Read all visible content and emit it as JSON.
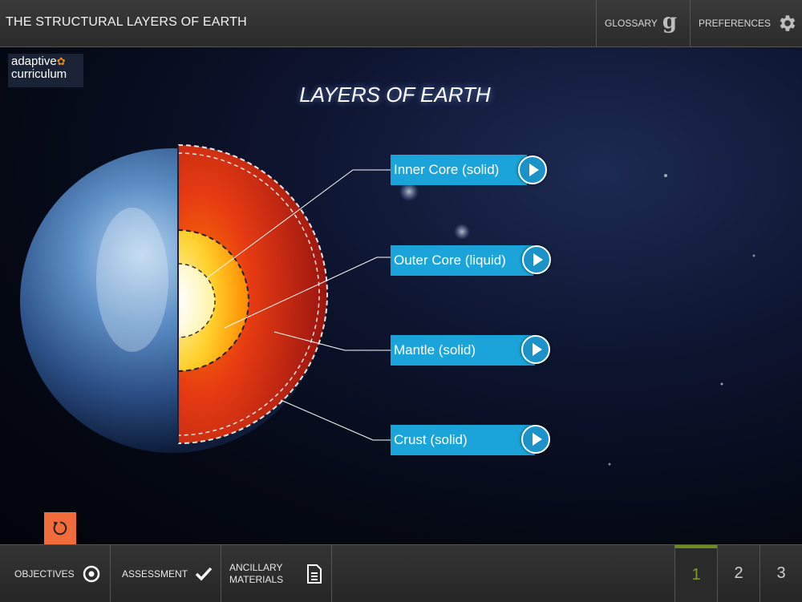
{
  "header": {
    "title": "THE STRUCTURAL LAYERS OF EARTH",
    "glossary_label": "GLOSSARY",
    "preferences_label": "PREFERENCES"
  },
  "logo": {
    "line1": "adaptive",
    "line2": "curriculum"
  },
  "stage": {
    "title": "LAYERS OF EARTH",
    "layers": [
      {
        "label": "Inner Core (solid)"
      },
      {
        "label": "Outer Core (liquid)"
      },
      {
        "label": "Mantle (solid)"
      },
      {
        "label": "Crust (solid)"
      }
    ]
  },
  "footer": {
    "objectives_label": "OBJECTIVES",
    "assessment_label": "ASSESSMENT",
    "ancillary_line1": "ANCILLARY",
    "ancillary_line2": "MATERIALS",
    "pages": [
      "1",
      "2",
      "3"
    ],
    "current_page": "1"
  },
  "colors": {
    "accent": "#1ba4d9",
    "reset": "#f26b3a",
    "active_page": "#7f9a2a"
  }
}
